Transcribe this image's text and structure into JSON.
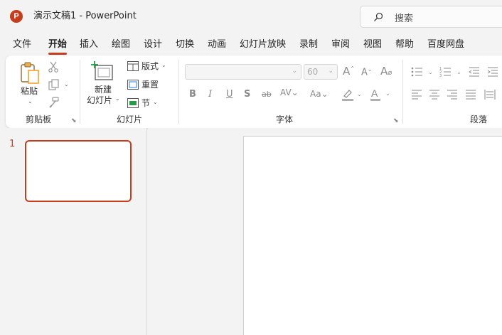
{
  "titlebar": {
    "app_icon": "P",
    "title": "演示文稿1  -  PowerPoint",
    "search_placeholder": "搜索"
  },
  "tabs": [
    {
      "label": "文件",
      "active": false
    },
    {
      "label": "开始",
      "active": true
    },
    {
      "label": "插入",
      "active": false
    },
    {
      "label": "绘图",
      "active": false
    },
    {
      "label": "设计",
      "active": false
    },
    {
      "label": "切换",
      "active": false
    },
    {
      "label": "动画",
      "active": false
    },
    {
      "label": "幻灯片放映",
      "active": false
    },
    {
      "label": "录制",
      "active": false
    },
    {
      "label": "审阅",
      "active": false
    },
    {
      "label": "视图",
      "active": false
    },
    {
      "label": "帮助",
      "active": false
    },
    {
      "label": "百度网盘",
      "active": false
    }
  ],
  "ribbon": {
    "clipboard": {
      "paste_label": "粘贴",
      "group_label": "剪贴板"
    },
    "slides": {
      "new_slide_line1": "新建",
      "new_slide_line2": "幻灯片",
      "layout_label": "版式",
      "reset_label": "重置",
      "section_label": "节",
      "group_label": "幻灯片"
    },
    "font": {
      "font_name_value": "",
      "font_size_value": "60",
      "group_label": "字体"
    },
    "paragraph": {
      "group_label": "段落"
    }
  },
  "thumbnails": {
    "slide_number": "1"
  },
  "colors": {
    "accent": "#c43e1c",
    "ribbon_bg": "#ffffff",
    "app_bg": "#f3f3f3"
  }
}
